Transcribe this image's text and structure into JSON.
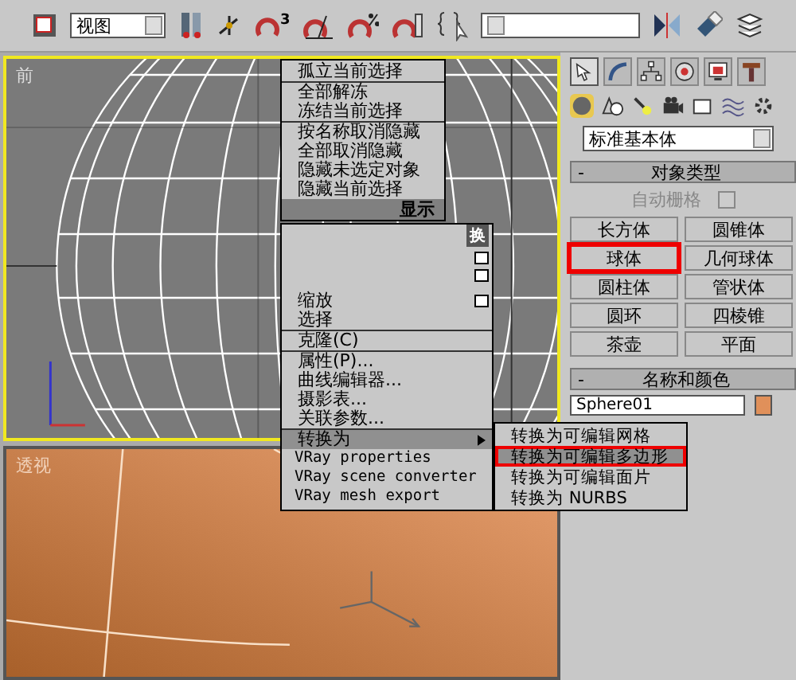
{
  "toolbar": {
    "view_dropdown": "视图",
    "snap_count": "3"
  },
  "viewports": [
    {
      "label": "前",
      "kind": "front",
      "selected": true
    },
    {
      "label": "透视",
      "kind": "perspective",
      "selected": false
    }
  ],
  "quad_menu": {
    "header": "显示",
    "groups": [
      [
        {
          "label": "孤立当前选择"
        }
      ],
      [
        {
          "label": "全部解冻"
        },
        {
          "label": "冻结当前选择"
        }
      ],
      [
        {
          "label": "按名称取消隐藏"
        },
        {
          "label": "全部取消隐藏"
        },
        {
          "label": "隐藏未选定对象"
        },
        {
          "label": "隐藏当前选择"
        }
      ]
    ]
  },
  "transform_menu": {
    "header": "换",
    "groups": [
      [
        {
          "label": "缩放",
          "selected": false,
          "submenu": false
        },
        {
          "label": "选择",
          "selected": false,
          "submenu": false
        }
      ],
      [
        {
          "label": "克隆(C)",
          "selected": false,
          "submenu": false
        }
      ],
      [
        {
          "label": "属性(P)...",
          "selected": false,
          "submenu": false
        },
        {
          "label": "曲线编辑器...",
          "selected": false,
          "submenu": false
        },
        {
          "label": "摄影表...",
          "selected": false,
          "submenu": false
        },
        {
          "label": "关联参数...",
          "selected": false,
          "submenu": false
        }
      ],
      [
        {
          "label": "转换为",
          "selected": true,
          "submenu": true
        },
        {
          "label": "VRay properties",
          "selected": false,
          "submenu": false
        },
        {
          "label": "VRay scene converter",
          "selected": false,
          "submenu": false
        },
        {
          "label": "VRay mesh export",
          "selected": false,
          "submenu": false
        }
      ]
    ]
  },
  "submenu": [
    {
      "label": "转换为可编辑网格",
      "selected": false
    },
    {
      "label": "转换为可编辑多边形",
      "selected": true
    },
    {
      "label": "转换为可编辑面片",
      "selected": false
    },
    {
      "label": "转换为 NURBS",
      "selected": false
    }
  ],
  "command_panel": {
    "category": "标准基本体",
    "object_type": {
      "collapse_mark": "-",
      "title": "对象类型",
      "autogrid": {
        "label": "自动栅格",
        "checked": false,
        "disabled": true
      },
      "buttons": [
        {
          "label": "长方体",
          "selected": false
        },
        {
          "label": "圆锥体",
          "selected": false
        },
        {
          "label": "球体",
          "selected": true
        },
        {
          "label": "几何球体",
          "selected": false
        },
        {
          "label": "圆柱体",
          "selected": false
        },
        {
          "label": "管状体",
          "selected": false
        },
        {
          "label": "圆环",
          "selected": false
        },
        {
          "label": "四棱锥",
          "selected": false
        },
        {
          "label": "茶壶",
          "selected": false
        },
        {
          "label": "平面",
          "selected": false
        }
      ]
    },
    "name_and_color": {
      "collapse_mark": "-",
      "title": "名称和颜色",
      "name": "Sphere01",
      "color": "#e0905a"
    }
  }
}
